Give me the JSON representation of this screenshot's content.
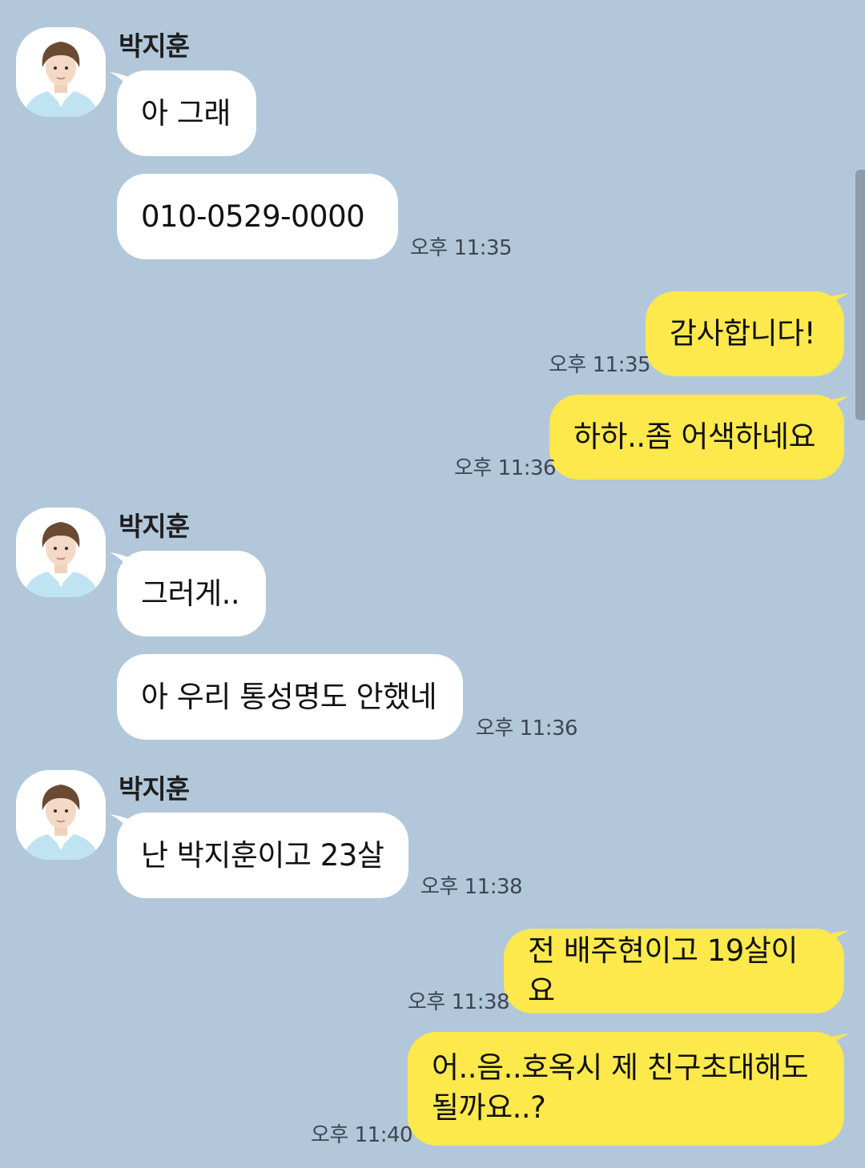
{
  "conversation": {
    "groups": [
      {
        "sender": "박지훈",
        "messages": [
          "아 그래",
          "010-0529-0000"
        ],
        "time": "오후 11:35"
      },
      {
        "sender": "me",
        "messages": [
          "감사합니다!"
        ],
        "time": "오후 11:35"
      },
      {
        "sender": "me",
        "messages": [
          "하하..좀 어색하네요"
        ],
        "time": "오후 11:36"
      },
      {
        "sender": "박지훈",
        "messages": [
          "그러게..",
          "아 우리 통성명도 안했네"
        ],
        "time": "오후 11:36"
      },
      {
        "sender": "박지훈",
        "messages": [
          "난 박지훈이고 23살"
        ],
        "time": "오후 11:38"
      },
      {
        "sender": "me",
        "messages": [
          "전 배주현이고 19살이요"
        ],
        "time": "오후 11:38"
      },
      {
        "sender": "me",
        "messages": [
          "어..음..호옥시 제 친구초대해도 될까요..?"
        ],
        "time": "오후 11:40"
      }
    ]
  },
  "colors": {
    "background": "#b2c7da",
    "outgoing_bubble": "#fee94d",
    "incoming_bubble": "#ffffff",
    "timestamp_text": "#3d4651"
  }
}
